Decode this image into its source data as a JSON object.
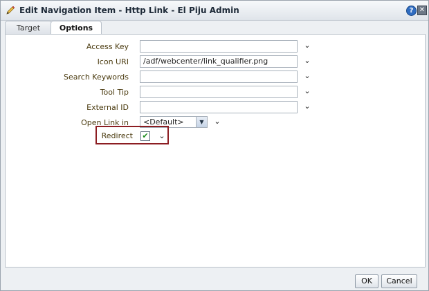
{
  "dialog": {
    "title": "Edit Navigation Item - Http Link - El Piju Admin",
    "help_glyph": "?",
    "close_glyph": "✕"
  },
  "tabs": [
    {
      "label": "Target",
      "selected": false
    },
    {
      "label": "Options",
      "selected": true
    }
  ],
  "form": {
    "access_key": {
      "label": "Access Key",
      "value": ""
    },
    "icon_uri": {
      "label": "Icon URI",
      "value": "/adf/webcenter/link_qualifier.png"
    },
    "search_keywords": {
      "label": "Search Keywords",
      "value": ""
    },
    "tool_tip": {
      "label": "Tool Tip",
      "value": ""
    },
    "external_id": {
      "label": "External ID",
      "value": ""
    },
    "open_link_in": {
      "label": "Open Link in",
      "value": "<Default>"
    },
    "redirect": {
      "label": "Redirect",
      "checked": true,
      "check_glyph": "✔"
    },
    "chevron_glyph": "⌄"
  },
  "footer": {
    "ok_label": "OK",
    "cancel_label": "Cancel"
  },
  "colors": {
    "highlight_border": "#8c1d22",
    "label_text": "#4a3a0e"
  },
  "icons": {
    "title": "pencil-icon",
    "help": "help-icon",
    "close": "close-icon"
  }
}
